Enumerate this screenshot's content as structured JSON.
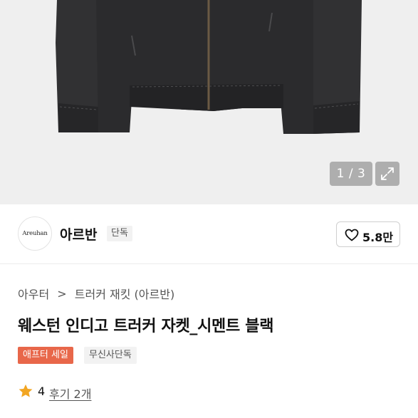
{
  "gallery": {
    "counter": "1 / 3",
    "current": 1,
    "total": 3
  },
  "brand": {
    "logo_text": "Areuhan",
    "name": "아르반",
    "badge": "단독"
  },
  "like": {
    "count": "5.8만"
  },
  "breadcrumb": {
    "items": [
      "아우터",
      "트러커 재킷 (아르반)"
    ],
    "separator": ">"
  },
  "product": {
    "title": "웨스턴 인디고 트러커 자켓_시멘트 블랙"
  },
  "tags": {
    "sale": "애프터 세일",
    "exclusive": "무신사단독"
  },
  "rating": {
    "value": "4",
    "review_link": "후기 2개"
  },
  "colors": {
    "sale_tag": "#e8674a",
    "star": "#f2a623",
    "image_bg": "#efefef"
  }
}
